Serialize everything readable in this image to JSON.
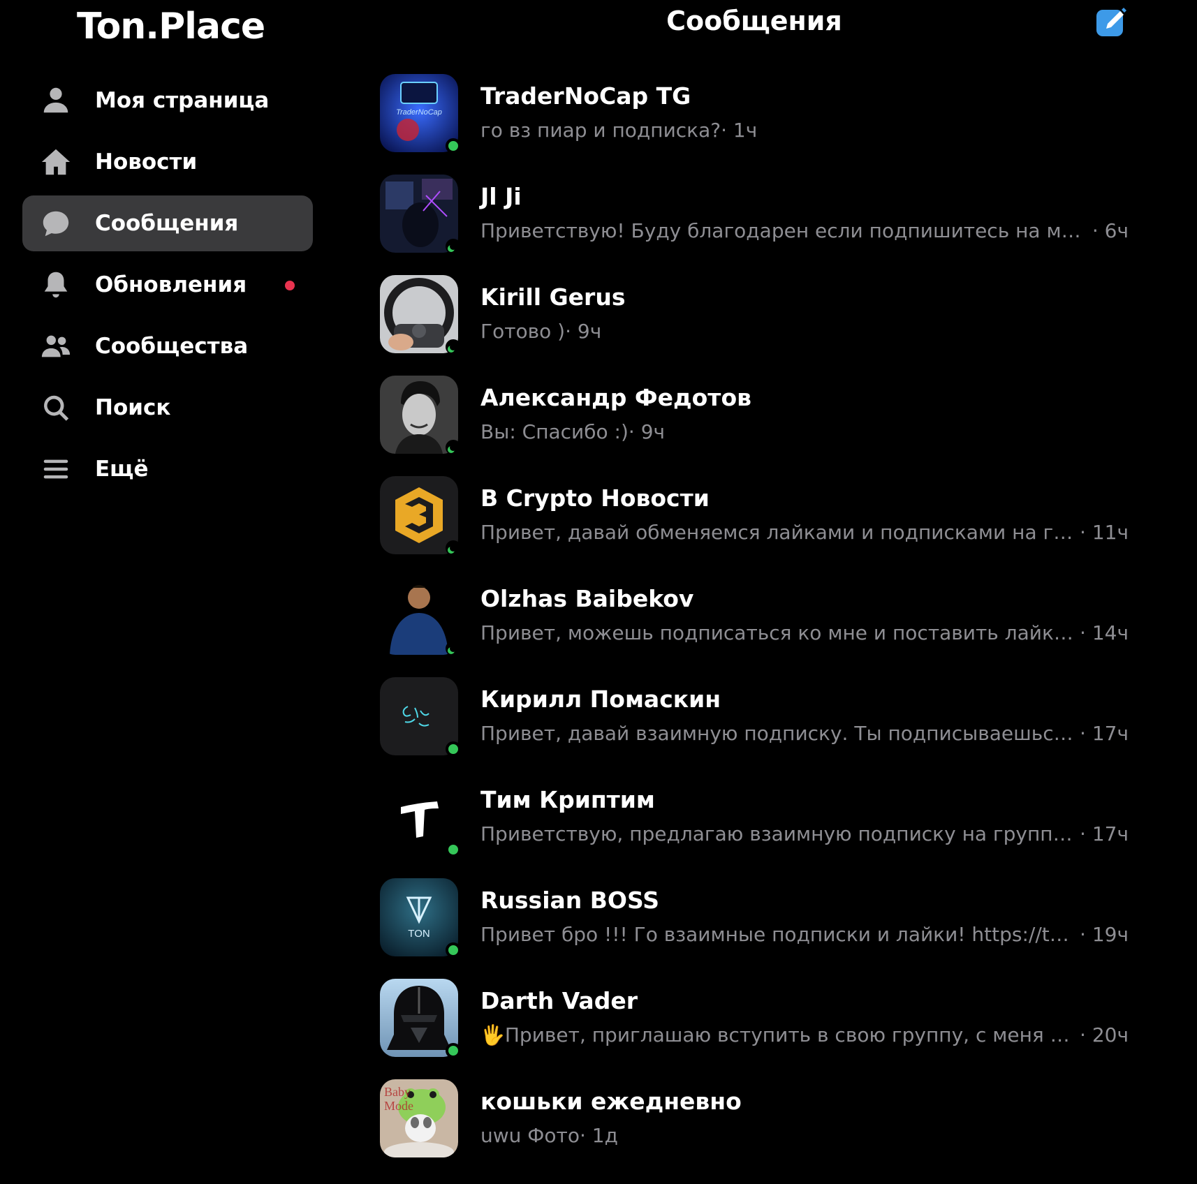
{
  "app": {
    "logo": "Ton.Place"
  },
  "header": {
    "title": "Сообщения",
    "compose_icon": "compose-icon",
    "accent": "#3d9ae8"
  },
  "sidebar": {
    "items": [
      {
        "label": "Моя страница",
        "icon": "person-icon",
        "active": false
      },
      {
        "label": "Новости",
        "icon": "home-icon",
        "active": false
      },
      {
        "label": "Сообщения",
        "icon": "chat-bubble-icon",
        "active": true
      },
      {
        "label": "Обновления",
        "icon": "bell-icon",
        "active": false,
        "has_dot": true,
        "dot_color": "#e8334f"
      },
      {
        "label": "Сообщества",
        "icon": "group-icon",
        "active": false
      },
      {
        "label": "Поиск",
        "icon": "search-icon",
        "active": false
      },
      {
        "label": "Ещё",
        "icon": "menu-icon",
        "active": false
      }
    ]
  },
  "conversations": [
    {
      "name": "TraderNoCap TG",
      "message": "го вз пиар и подписка?",
      "time": "· 1ч",
      "status": "online"
    },
    {
      "name": "Jl Ji",
      "message": "Приветствую! Буду благодарен если подпишитесь на мое со...",
      "time": " · 6ч",
      "status": "idle"
    },
    {
      "name": "Kirill Gerus",
      "message": "Готово )",
      "time": "· 9ч",
      "status": "idle"
    },
    {
      "name": "Александр Федотов",
      "message": "Вы: Спасибо :)",
      "time": "· 9ч",
      "status": "idle"
    },
    {
      "name": "B Crypto Новости",
      "message": "Привет, давай обменяемся лайками и подписками на груп...",
      "time": "  · 11ч",
      "status": "idle"
    },
    {
      "name": "Olzhas Baibekov",
      "message": "Привет, можешь подписаться ко мне и поставить лайки на ...",
      "time": "· 14ч",
      "status": "idle"
    },
    {
      "name": "Кирилл Помаскин",
      "message": "Привет, давай взаимную подписку. Ты подписываешься на...",
      "time": "· 17ч",
      "status": "online"
    },
    {
      "name": "Тим Криптим",
      "message": "Приветствую, предлагаю взаимную подписку на группу, то...",
      "time": "· 17ч",
      "status": "online"
    },
    {
      "name": "Russian BOSS",
      "message": "Привет бро !!! Го взаимные подписки и лайки! https://ton.pla...",
      "time": "· 19ч",
      "status": "online"
    },
    {
      "name": "Darth Vader",
      "prefix": "🖐",
      "message": "Привет, приглашаю вступить в свою группу, с меня в от...",
      "time": " · 20ч",
      "status": "online"
    },
    {
      "name": "кошьки ежедневно",
      "message": "uwu Фото",
      "time": "· 1д",
      "status": "none",
      "avatar_text": "Baby Mode"
    }
  ],
  "colors": {
    "background": "#000000",
    "active_nav": "#3a3a3c",
    "muted_text": "#8e8e93",
    "online": "#35c759"
  }
}
